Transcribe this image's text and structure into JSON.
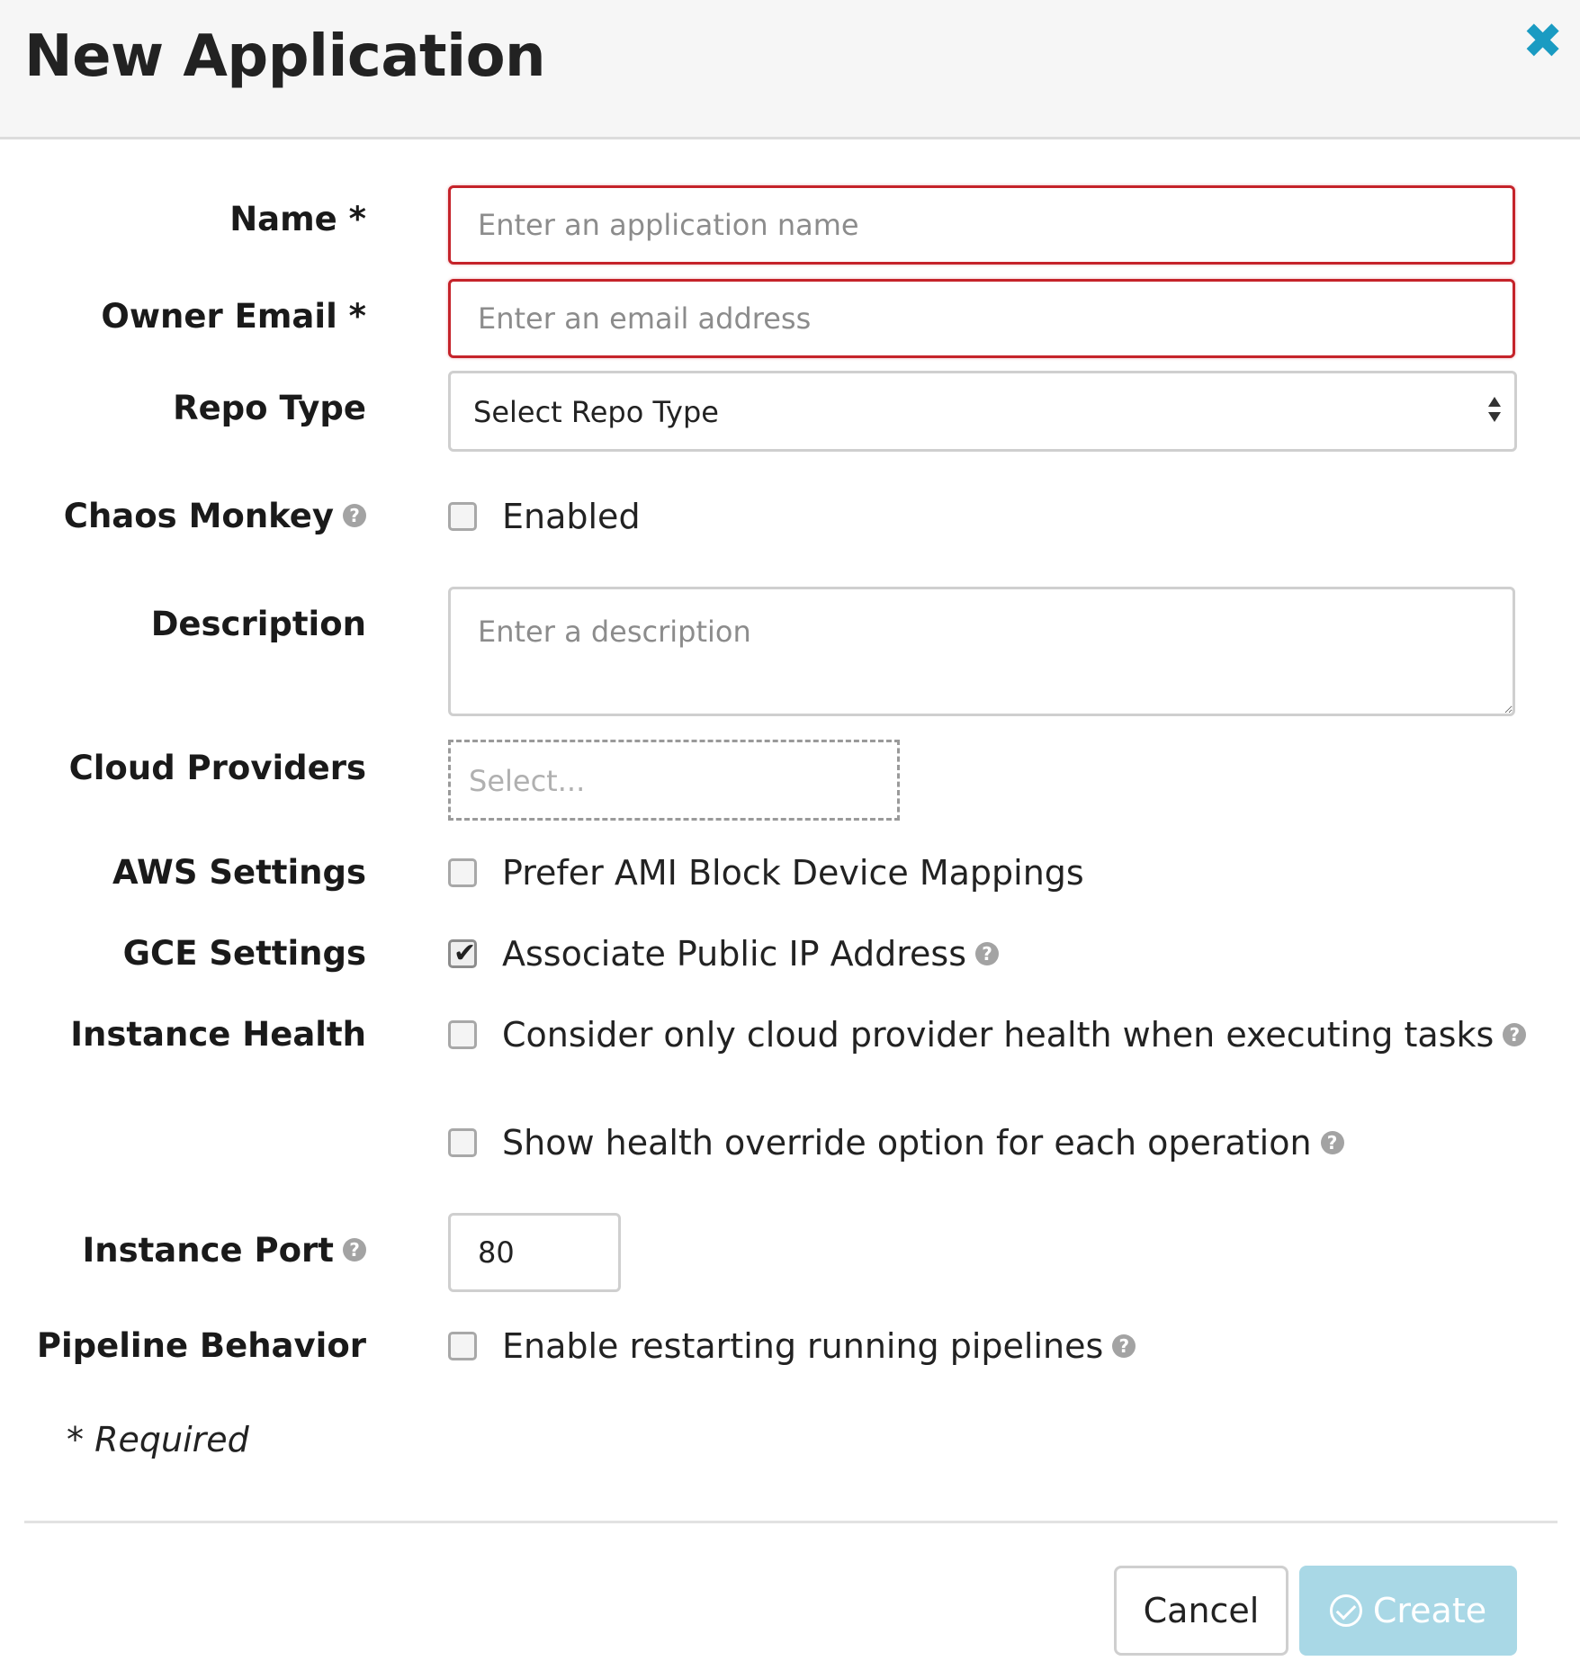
{
  "dialog": {
    "title": "New Application",
    "close_icon": "close-icon"
  },
  "form": {
    "name": {
      "label": "Name *",
      "placeholder": "Enter an application name",
      "value": ""
    },
    "owner_email": {
      "label": "Owner Email *",
      "placeholder": "Enter an email address",
      "value": ""
    },
    "repo_type": {
      "label": "Repo Type",
      "selected": "Select Repo Type"
    },
    "chaos_monkey": {
      "label": "Chaos Monkey",
      "option": "Enabled",
      "checked": false
    },
    "description": {
      "label": "Description",
      "placeholder": "Enter a description",
      "value": ""
    },
    "cloud_providers": {
      "label": "Cloud Providers",
      "placeholder": "Select..."
    },
    "aws_settings": {
      "label": "AWS Settings",
      "option": "Prefer AMI Block Device Mappings",
      "checked": false
    },
    "gce_settings": {
      "label": "GCE Settings",
      "option": "Associate Public IP Address",
      "checked": true
    },
    "instance_health": {
      "label": "Instance Health",
      "options": [
        {
          "text": "Consider only cloud provider health when executing tasks",
          "checked": false
        },
        {
          "text": "Show health override option for each operation",
          "checked": false
        }
      ]
    },
    "instance_port": {
      "label": "Instance Port",
      "value": "80"
    },
    "pipeline_behavior": {
      "label": "Pipeline Behavior",
      "option": "Enable restarting running pipelines",
      "checked": false
    },
    "required_note": "* Required"
  },
  "footer": {
    "cancel_label": "Cancel",
    "create_label": "Create"
  },
  "colors": {
    "close_icon": "#1a9bc2",
    "error_border": "#c5232a",
    "create_button_bg": "#a9d8e6"
  }
}
